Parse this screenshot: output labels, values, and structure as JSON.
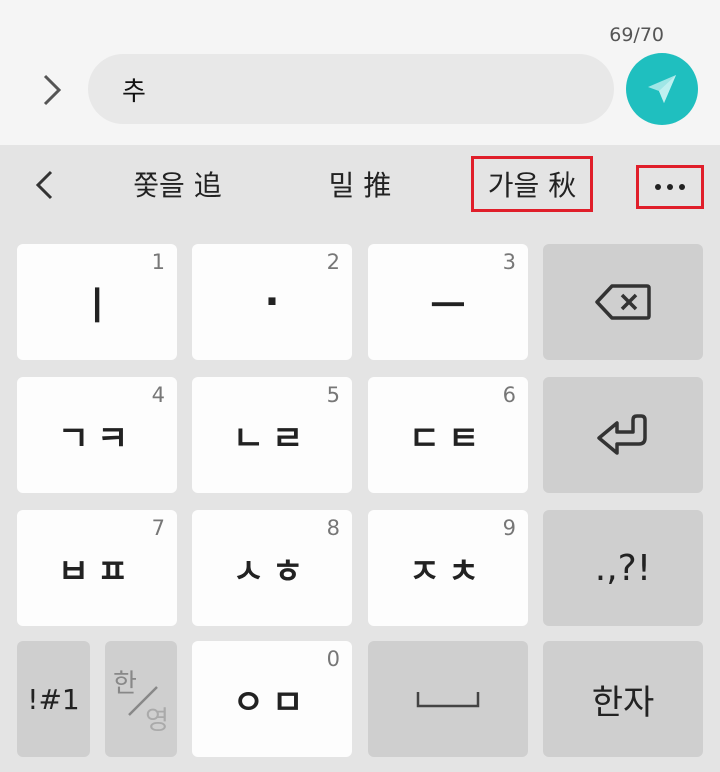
{
  "composer": {
    "counter": "69/70",
    "text": "추"
  },
  "suggestions": {
    "items": [
      "쫓을 追",
      "밀 推",
      "가을 秋"
    ]
  },
  "keys": {
    "row1": [
      {
        "label": "ㅣ",
        "num": "1"
      },
      {
        "label": "·",
        "num": "2"
      },
      {
        "label": "ㅡ",
        "num": "3"
      }
    ],
    "row2": [
      {
        "label": "ㄱㅋ",
        "num": "4"
      },
      {
        "label": "ㄴㄹ",
        "num": "5"
      },
      {
        "label": "ㄷㅌ",
        "num": "6"
      }
    ],
    "row3": [
      {
        "label": "ㅂㅍ",
        "num": "7"
      },
      {
        "label": "ㅅㅎ",
        "num": "8"
      },
      {
        "label": "ㅈㅊ",
        "num": "9"
      }
    ],
    "row4": [
      {
        "label": "ㅇㅁ",
        "num": "0"
      }
    ],
    "punctuation": ".,?!",
    "symbols": "!#1",
    "han": "한",
    "young": "영",
    "hanja": "한자"
  },
  "colors": {
    "send_button": "#1fbfbf",
    "highlight_box": "#e01e2a"
  },
  "icons": {
    "expand": "chevron-right-icon",
    "send": "paper-plane-icon",
    "back": "chevron-left-icon",
    "more": "more-horizontal-icon",
    "backspace": "backspace-icon",
    "enter": "enter-icon",
    "space": "space-bar-icon"
  }
}
